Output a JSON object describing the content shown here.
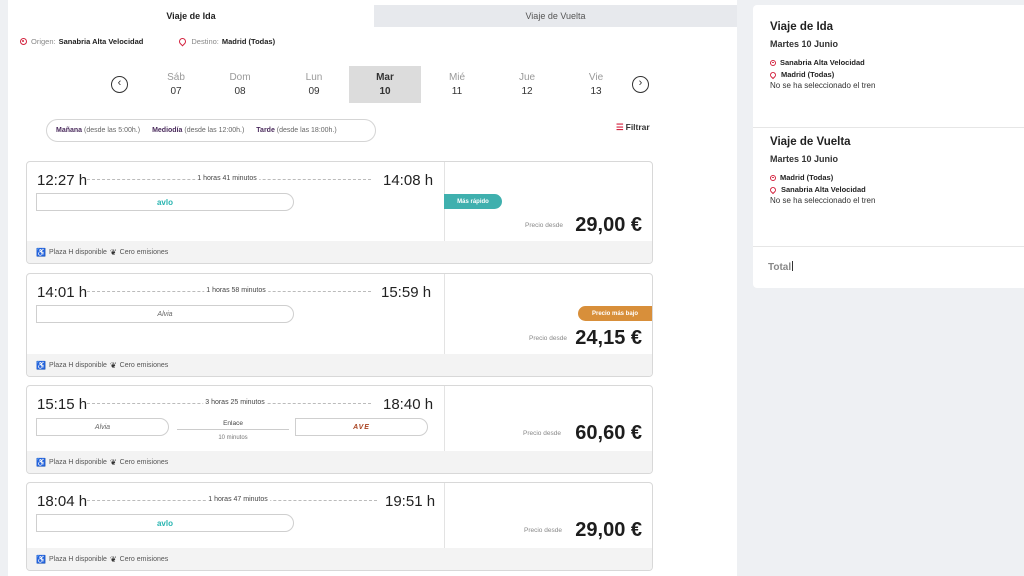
{
  "tabs": {
    "outbound": "Viaje de Ida",
    "return": "Viaje de Vuelta"
  },
  "route": {
    "origin_label": "Origen:",
    "origin": "Sanabria Alta Velocidad",
    "dest_label": "Destino:",
    "dest": "Madrid (Todas)"
  },
  "dates": [
    {
      "name": "Sáb",
      "day": "07"
    },
    {
      "name": "Dom",
      "day": "08"
    },
    {
      "name": "Lun",
      "day": "09"
    },
    {
      "name": "Mar",
      "day": "10"
    },
    {
      "name": "Mié",
      "day": "11"
    },
    {
      "name": "Jue",
      "day": "12"
    },
    {
      "name": "Vie",
      "day": "13"
    }
  ],
  "time_filters": [
    {
      "label": "Mañana",
      "sub": "(desde las 5:00h.)"
    },
    {
      "label": "Mediodía",
      "sub": "(desde las 12:00h.)"
    },
    {
      "label": "Tarde",
      "sub": "(desde las 18:00h.)"
    }
  ],
  "filter_label": "Filtrar",
  "price_label": "Precio desde",
  "footer": {
    "accessible": "Plaza H disponible",
    "emissions": "Cero emisiones"
  },
  "trips": [
    {
      "dep": "12:27 h",
      "arr": "14:08 h",
      "duration": "1 horas 41 minutos",
      "train": "avlo",
      "badge": "Más rápido",
      "price": "29,00 €"
    },
    {
      "dep": "14:01 h",
      "arr": "15:59 h",
      "duration": "1 horas 58 minutos",
      "train": "Alvia",
      "badge": "Precio más bajo",
      "price": "24,15 €"
    },
    {
      "dep": "15:15 h",
      "arr": "18:40 h",
      "duration": "3 horas 25 minutos",
      "train": "Alvia",
      "train2": "AVE",
      "connection": "Enlace",
      "connection_time": "10 minutos",
      "price": "60,60 €"
    },
    {
      "dep": "18:04 h",
      "arr": "19:51 h",
      "duration": "1 horas 47 minutos",
      "train": "avlo",
      "price": "29,00 €"
    }
  ],
  "summary": {
    "outbound": {
      "title": "Viaje de Ida",
      "date": "Martes 10 Junio",
      "from": "Sanabria Alta Velocidad",
      "to": "Madrid (Todas)",
      "note": "No se ha seleccionado el tren"
    },
    "return": {
      "title": "Viaje de Vuelta",
      "date": "Martes 10 Junio",
      "from": "Madrid (Todas)",
      "to": "Sanabria Alta Velocidad",
      "note": "No se ha seleccionado el tren"
    },
    "total": "Total"
  },
  "colors": {
    "brand_red": "#d3233f",
    "fast_badge": "#3fb0ae",
    "cheap_badge": "#d88f3a",
    "avlo": "#27b4b0"
  }
}
